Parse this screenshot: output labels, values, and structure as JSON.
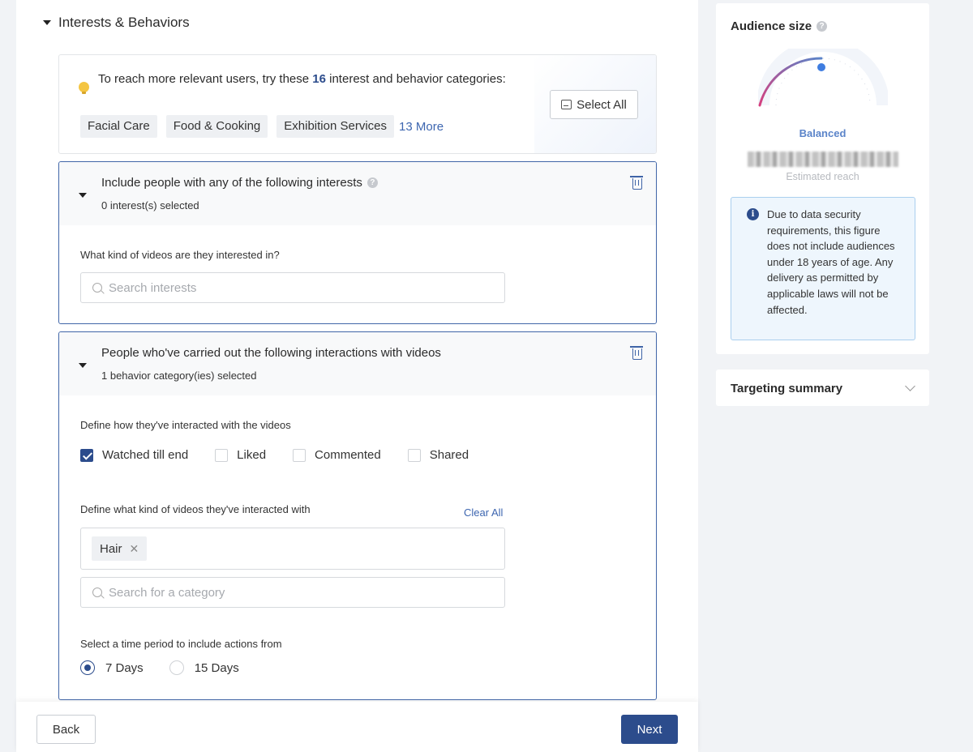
{
  "section": {
    "title": "Interests & Behaviors"
  },
  "suggestion": {
    "text_before": "To reach more relevant users, try these ",
    "count": "16",
    "text_after": " interest and behavior categories:",
    "tags": [
      "Facial Care",
      "Food & Cooking",
      "Exhibition Services"
    ],
    "more_label": "13 More",
    "select_all_label": "Select All"
  },
  "interests_card": {
    "title": "Include people with any of the following interests",
    "subtitle": "0 interest(s) selected",
    "question": "What kind of videos are they interested in?",
    "search_placeholder": "Search interests"
  },
  "behaviors_card": {
    "title": "People who've carried out the following interactions with videos",
    "subtitle": "1 behavior category(ies) selected",
    "interaction_label": "Define how they've interacted with the videos",
    "interactions": [
      {
        "label": "Watched till end",
        "checked": true
      },
      {
        "label": "Liked",
        "checked": false
      },
      {
        "label": "Commented",
        "checked": false
      },
      {
        "label": "Shared",
        "checked": false
      }
    ],
    "video_kind_label": "Define what kind of videos they've interacted with",
    "clear_all_label": "Clear All",
    "selected_chip": "Hair",
    "category_placeholder": "Search for a category",
    "period_label": "Select a time period to include actions from",
    "periods": [
      {
        "label": "7 Days",
        "selected": true
      },
      {
        "label": "15 Days",
        "selected": false
      }
    ]
  },
  "footer": {
    "back_label": "Back",
    "next_label": "Next"
  },
  "audience": {
    "title": "Audience size",
    "status": "Balanced",
    "estimated_reach_label": "Estimated reach",
    "notice": "Due to data security requirements, this figure does not include audiences under 18 years of age. Any delivery as permitted by applicable laws will not be affected."
  },
  "targeting_summary": {
    "title": "Targeting summary"
  },
  "colors": {
    "primary": "#2c4c8c",
    "link": "#3d66b0",
    "card_border": "#4166a8",
    "gauge_pink": "#d63f7e"
  }
}
